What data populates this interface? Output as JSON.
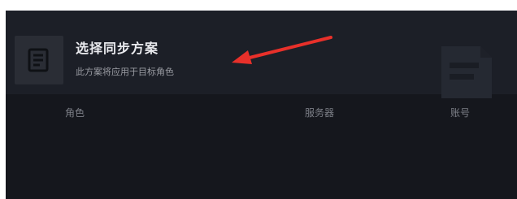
{
  "sync_dialog": {
    "title": "选择同步方案",
    "subtitle": "此方案将应用于目标角色"
  },
  "table": {
    "columns": [
      "角色",
      "服务器",
      "账号"
    ]
  },
  "colors": {
    "panel_bg": "#15171d",
    "header_bg": "#1c1f27",
    "arrow": "#e8302a"
  },
  "icons": [
    "document-icon",
    "document-icon-watermark",
    "annotation-arrow"
  ]
}
